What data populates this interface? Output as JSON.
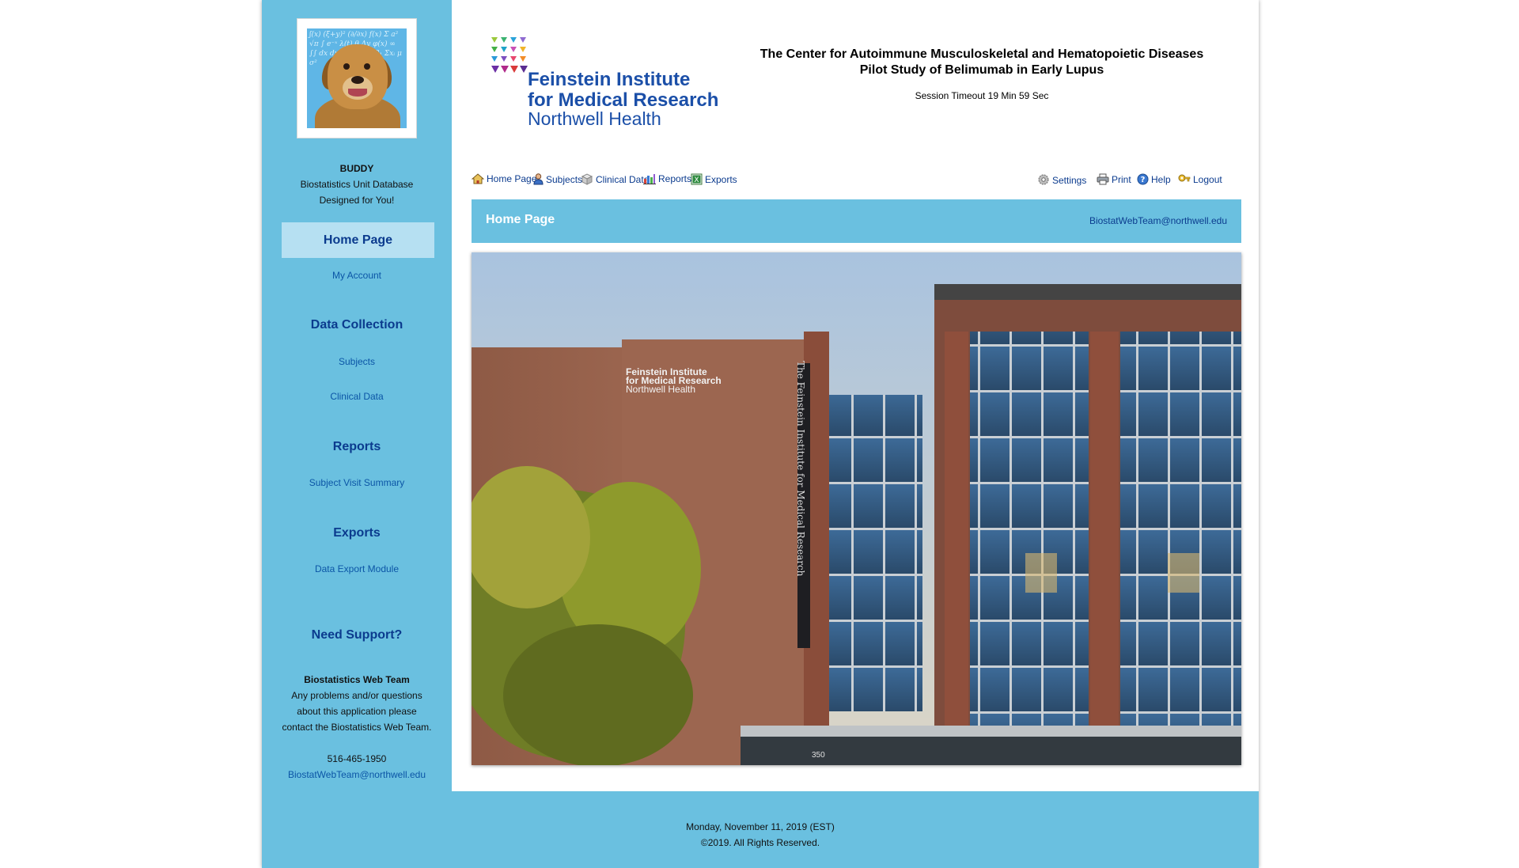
{
  "sidebar": {
    "user_name": "BUDDY",
    "tagline_1": "Biostatistics Unit Database",
    "tagline_2": "Designed for You!",
    "home_heading": "Home Page",
    "my_account": "My Account",
    "data_collection_heading": "Data Collection",
    "subjects": "Subjects",
    "clinical_data": "Clinical Data",
    "reports_heading": "Reports",
    "subject_visit_summary": "Subject Visit Summary",
    "exports_heading": "Exports",
    "data_export_module": "Data Export Module",
    "support_heading": "Need Support?",
    "support_team": "Biostatistics Web Team",
    "support_line_1": "Any problems and/or questions",
    "support_line_2": "about this application please",
    "support_line_3": "contact the Biostatistics Web Team.",
    "support_phone": "516-465-1950",
    "support_email": "BiostatWebTeam@northwell.edu"
  },
  "header": {
    "logo_line_1": "Feinstein Institute",
    "logo_line_2": "for Medical Research",
    "logo_line_3": "Northwell Health",
    "title_line_1": "The Center for Autoimmune Musculoskeletal and Hematopoietic Diseases",
    "title_line_2": "Pilot Study of Belimumab in Early Lupus",
    "session_timeout": "Session Timeout 19 Min 59 Sec"
  },
  "toolbar": {
    "home": "Home Page",
    "subjects": "Subjects",
    "clinical_data": "Clinical Data",
    "reports": "Reports",
    "exports": "Exports",
    "settings": "Settings",
    "print": "Print",
    "help": "Help",
    "logout": "Logout"
  },
  "banner": {
    "title": "Home Page",
    "email": "BiostatWebTeam@northwell.edu"
  },
  "hero": {
    "sign_line_1": "Feinstein Institute",
    "sign_line_2": "for Medical Research",
    "sign_line_3": "Northwell Health",
    "vertical_sign": "The Feinstein Institute for Medical Research",
    "street_number": "350"
  },
  "footer": {
    "date": "Monday, November 11, 2019 (EST)",
    "copyright": "©2019. All Rights Reserved."
  },
  "icons": [
    "home-icon",
    "subjects-icon",
    "clinical-data-icon",
    "reports-icon",
    "exports-icon",
    "settings-icon",
    "print-icon",
    "help-icon",
    "logout-icon"
  ],
  "colors": {
    "sidebar_bg": "#6ac0e0",
    "nav_heading": "#0b3b8e",
    "link": "#0b55a6",
    "active_nav_bg": "#b6e0f2"
  }
}
